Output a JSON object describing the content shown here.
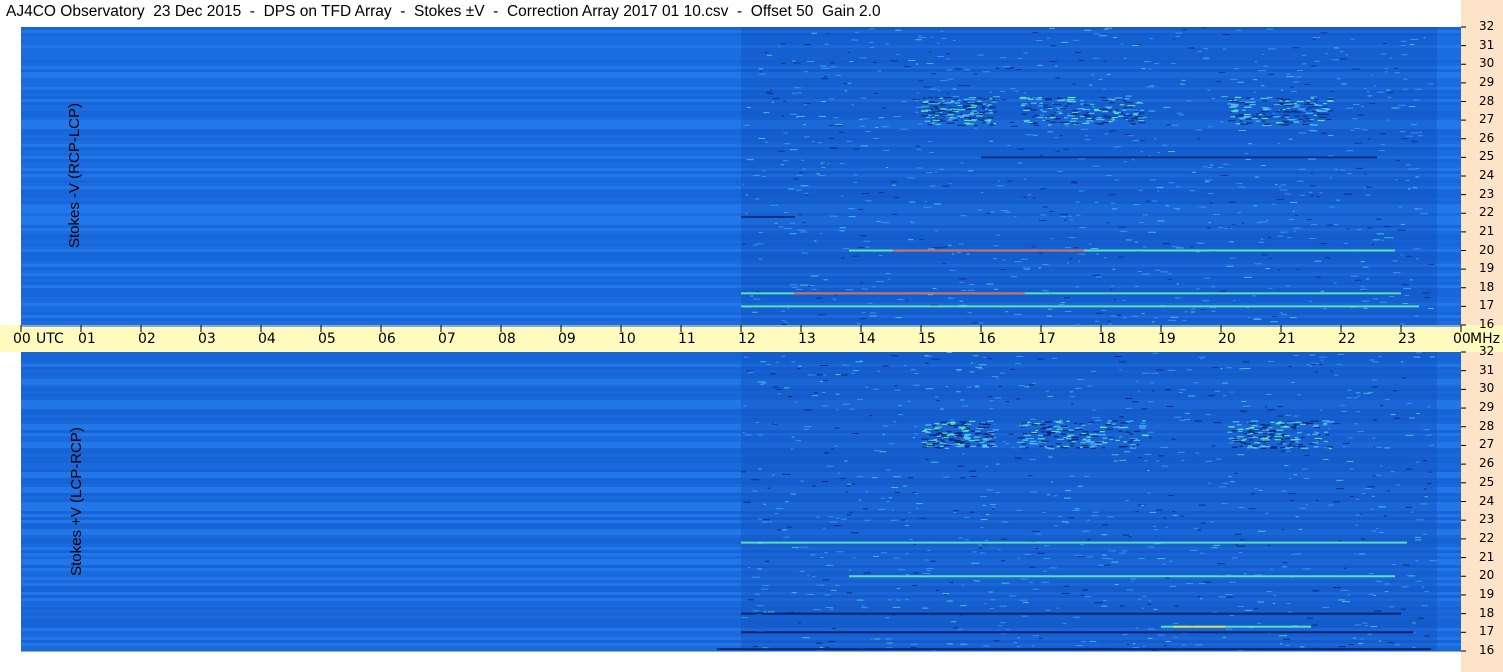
{
  "title": "AJ4CO Observatory  23 Dec 2015  -  DPS on TFD Array  -  Stokes ±V  -  Correction Array 2017 01 10.csv  -  Offset 50  Gain 2.0",
  "chart_data": [
    {
      "type": "heatmap",
      "panel": "top",
      "ylabel": "Stokes -V (RCP-LCP)",
      "x_unit_label": "UTC",
      "x_ticks": [
        "00",
        "01",
        "02",
        "03",
        "04",
        "05",
        "06",
        "07",
        "08",
        "09",
        "10",
        "11",
        "12",
        "13",
        "14",
        "15",
        "16",
        "17",
        "18",
        "19",
        "20",
        "21",
        "22",
        "23",
        "00"
      ],
      "y_unit_label": "MHz",
      "y_ticks": [
        "32",
        "31",
        "30",
        "29",
        "28",
        "27",
        "26",
        "25",
        "24",
        "23",
        "22",
        "21",
        "20",
        "19",
        "18",
        "17",
        "16"
      ],
      "xlim_hours": [
        0,
        24
      ],
      "ylim_mhz": [
        16,
        32
      ],
      "colors": {
        "background": "#1a70e6",
        "dark": "#0a2a7a",
        "bright": "#5ff0b0",
        "hot": "#ff4040"
      },
      "features": [
        {
          "desc": "dark band",
          "freq_mhz": 25.0,
          "start_hr": 16.0,
          "end_hr": 22.6
        },
        {
          "desc": "dark band",
          "freq_mhz": 21.8,
          "start_hr": 12.0,
          "end_hr": 12.9
        },
        {
          "desc": "bright band",
          "freq_mhz": 17.7,
          "start_hr": 12.0,
          "end_hr": 23.0
        },
        {
          "desc": "bright band",
          "freq_mhz": 17.0,
          "start_hr": 12.0,
          "end_hr": 23.3
        },
        {
          "desc": "bright band",
          "freq_mhz": 20.0,
          "start_hr": 13.8,
          "end_hr": 22.9
        },
        {
          "desc": "noise cluster",
          "freq_mhz": 27.5,
          "start_hr": 15.0,
          "end_hr": 16.2
        },
        {
          "desc": "noise cluster",
          "freq_mhz": 27.5,
          "start_hr": 16.6,
          "end_hr": 18.7
        },
        {
          "desc": "noise cluster",
          "freq_mhz": 27.5,
          "start_hr": 20.1,
          "end_hr": 21.8
        }
      ]
    },
    {
      "type": "heatmap",
      "panel": "bottom",
      "ylabel": "Stokes +V (LCP-RCP)",
      "x_unit_label": "UTC",
      "x_ticks": [
        "00",
        "01",
        "02",
        "03",
        "04",
        "05",
        "06",
        "07",
        "08",
        "09",
        "10",
        "11",
        "12",
        "13",
        "14",
        "15",
        "16",
        "17",
        "18",
        "19",
        "20",
        "21",
        "22",
        "23",
        "00"
      ],
      "y_unit_label": "MHz",
      "y_ticks": [
        "32",
        "31",
        "30",
        "29",
        "28",
        "27",
        "26",
        "25",
        "24",
        "23",
        "22",
        "21",
        "20",
        "19",
        "18",
        "17",
        "16"
      ],
      "xlim_hours": [
        0,
        24
      ],
      "ylim_mhz": [
        16,
        32
      ],
      "colors": {
        "background": "#1a6ae0",
        "dark": "#081e6a",
        "bright": "#5ff0b0",
        "hot": "#ffe040"
      },
      "features": [
        {
          "desc": "dark band",
          "freq_mhz": 18.0,
          "start_hr": 12.0,
          "end_hr": 23.0
        },
        {
          "desc": "dark band",
          "freq_mhz": 17.0,
          "start_hr": 12.0,
          "end_hr": 23.2
        },
        {
          "desc": "dark band",
          "freq_mhz": 16.1,
          "start_hr": 11.6,
          "end_hr": 23.5
        },
        {
          "desc": "bright band",
          "freq_mhz": 21.8,
          "start_hr": 12.0,
          "end_hr": 23.1
        },
        {
          "desc": "bright band",
          "freq_mhz": 17.3,
          "start_hr": 19.0,
          "end_hr": 21.5
        },
        {
          "desc": "bright band",
          "freq_mhz": 20.0,
          "start_hr": 13.8,
          "end_hr": 22.9
        },
        {
          "desc": "noise cluster",
          "freq_mhz": 27.6,
          "start_hr": 15.0,
          "end_hr": 16.2
        },
        {
          "desc": "noise cluster",
          "freq_mhz": 27.6,
          "start_hr": 16.6,
          "end_hr": 18.7
        },
        {
          "desc": "noise cluster",
          "freq_mhz": 27.6,
          "start_hr": 20.1,
          "end_hr": 21.8
        }
      ]
    }
  ]
}
